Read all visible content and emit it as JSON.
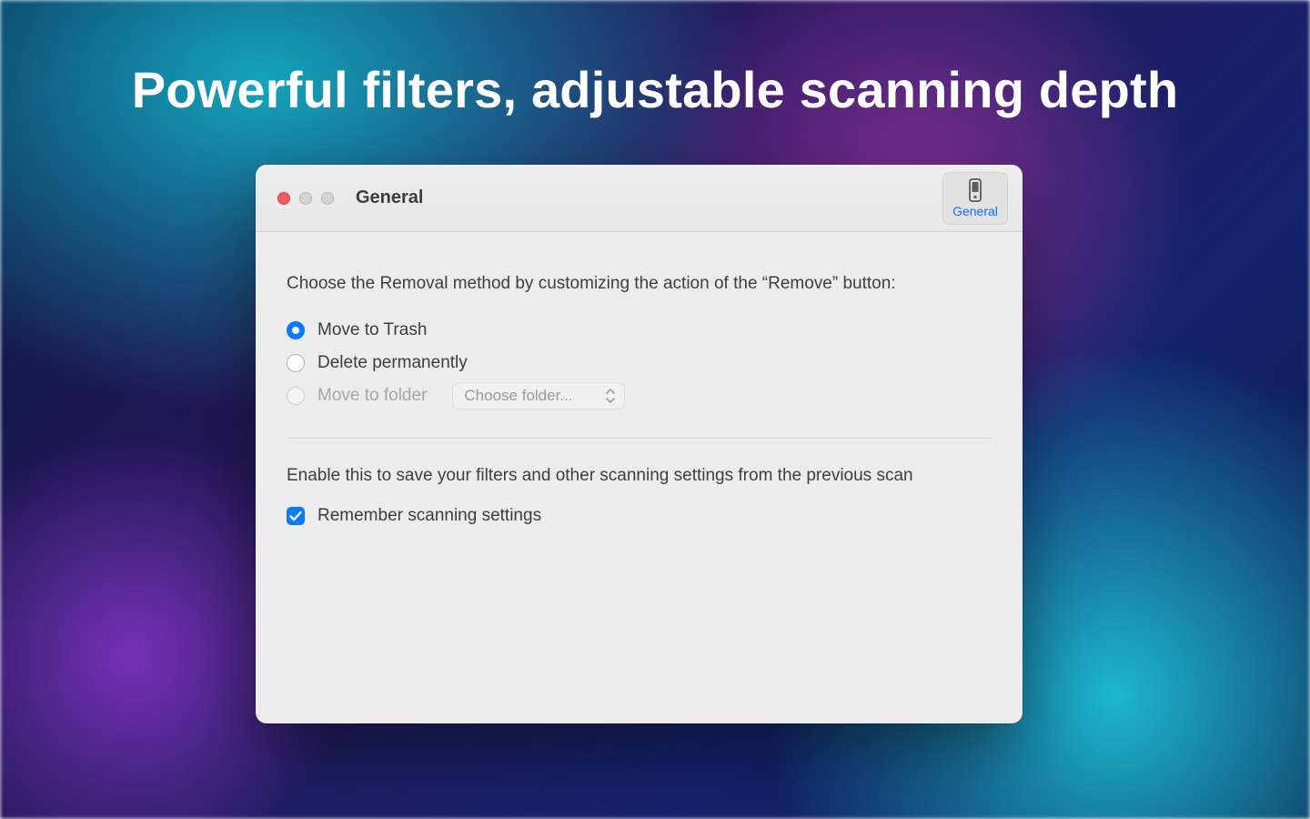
{
  "headline": "Powerful filters, adjustable scanning depth",
  "window": {
    "title": "General",
    "toolbar": {
      "general_label": "General"
    }
  },
  "removal": {
    "description": "Choose the Removal method by customizing the action of the “Remove” button:",
    "options": {
      "trash": "Move to Trash",
      "permanent": "Delete permanently",
      "folder": "Move to folder"
    },
    "folder_picker_placeholder": "Choose folder..."
  },
  "scanning": {
    "description": "Enable this to save your filters and other scanning settings from the previous scan",
    "remember_label": "Remember scanning settings"
  }
}
